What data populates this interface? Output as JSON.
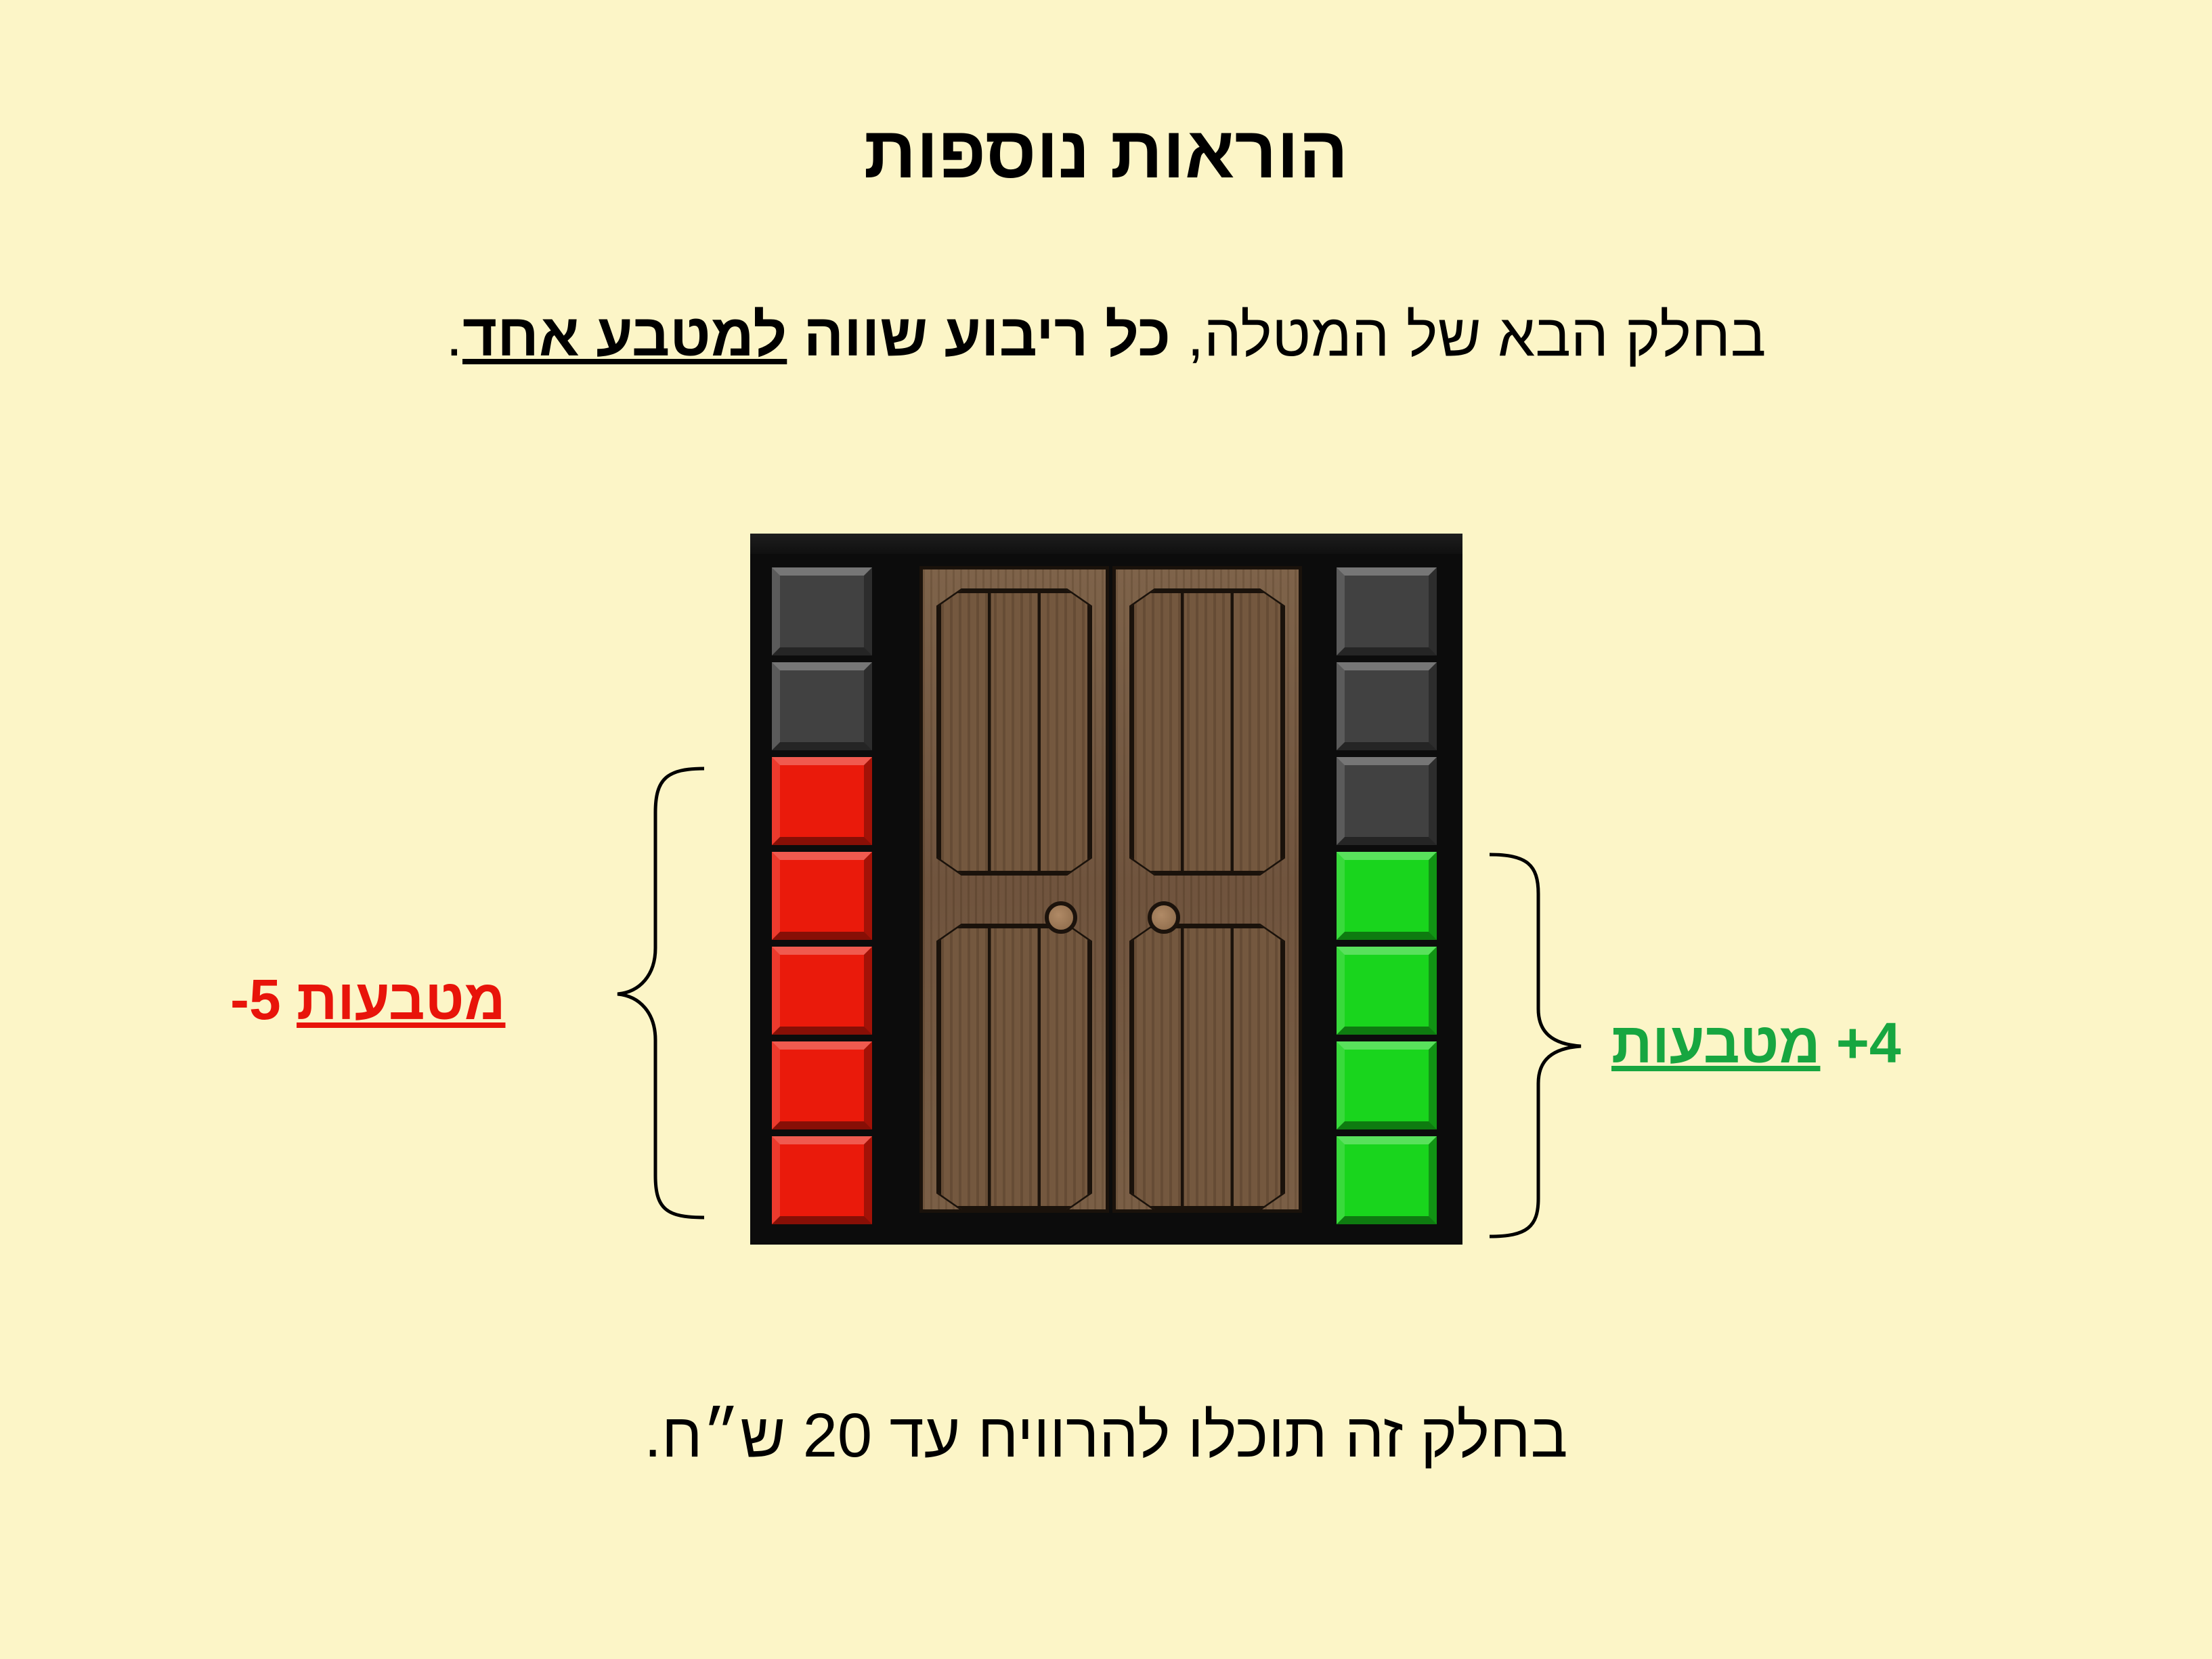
{
  "title": "הוראות נוספות",
  "instruction": {
    "prefix": "בחלק הבא של המטלה, ",
    "bold": "כל ריבוע שווה ",
    "underlined": "למטבע אחד",
    "suffix": "."
  },
  "left_label": {
    "amount": "-5",
    "unit": "מטבעות",
    "color": "#e8140a"
  },
  "right_label": {
    "amount": "+4",
    "unit": "מטבעות",
    "color": "#17a640"
  },
  "footer": "בחלק זה תוכלו להרוויח עד 20 ש״ח.",
  "left_column": [
    "gray",
    "gray",
    "red",
    "red",
    "red",
    "red",
    "red"
  ],
  "right_column": [
    "gray",
    "gray",
    "gray",
    "green",
    "green",
    "green",
    "green"
  ],
  "colors": {
    "background": "#fcf5c7",
    "red_tile": "#ea1a0b",
    "green_tile": "#19d51d",
    "gray_tile": "#414141",
    "door_wood": "#6f5339"
  }
}
